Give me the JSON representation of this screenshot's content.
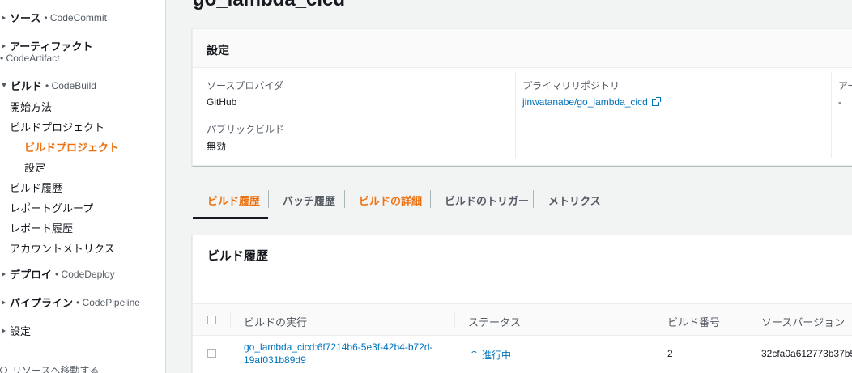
{
  "sidebar": {
    "sections": [
      {
        "label": "ソース",
        "service": "• CodeCommit"
      },
      {
        "label": "アーティファクト",
        "service": "• CodeArtifact"
      },
      {
        "label": "ビルド",
        "service": "• CodeBuild"
      },
      {
        "label": "デプロイ",
        "service": "• CodeDeploy"
      },
      {
        "label": "パイプライン",
        "service": "• CodePipeline"
      },
      {
        "label": "設定"
      }
    ],
    "build_items": [
      "開始方法",
      "ビルドプロジェクト",
      "ビルドプロジェクト",
      "設定",
      "ビルド履歴",
      "レポートグループ",
      "レポート履歴",
      "アカウントメトリクス"
    ],
    "footer": "リソースへ移動する"
  },
  "page": {
    "title": "go_lambda_cicd"
  },
  "settings": {
    "header": "設定",
    "source_provider_label": "ソースプロバイダ",
    "source_provider_value": "GitHub",
    "public_build_label": "パブリックビルド",
    "public_build_value": "無効",
    "primary_repo_label": "プライマリリポジトリ",
    "primary_repo_value": "jinwatanabe/go_lambda_cicd",
    "third_col_label": "アー",
    "third_col_value": "-"
  },
  "tabs": [
    "ビルド履歴",
    "バッチ履歴",
    "ビルドの詳細",
    "ビルドのトリガー",
    "メトリクス"
  ],
  "history": {
    "title": "ビルド履歴",
    "columns": [
      "ビルドの実行",
      "ステータス",
      "ビルド番号",
      "ソースバージョン"
    ],
    "rows": [
      {
        "run_line1": "go_lambda_cicd:6f7214b6-5e3f-42b4-b72d-",
        "run_line2": "19af031b89d9",
        "status": "進行中",
        "build_number": "2",
        "source_version": "32cfa0a612773b37b5"
      }
    ]
  },
  "colors": {
    "accent": "#ec7211",
    "link": "#0073bb",
    "text": "#16191f",
    "muted": "#545b64"
  }
}
